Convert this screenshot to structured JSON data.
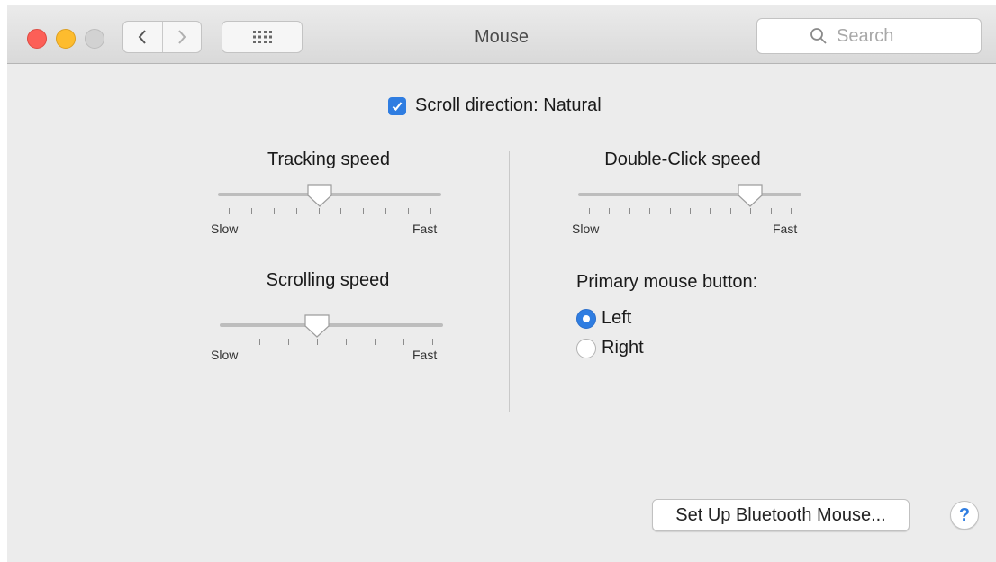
{
  "window": {
    "title": "Mouse"
  },
  "toolbar": {
    "back_icon": "chevron-left-icon",
    "forward_icon": "chevron-right-icon",
    "show_all_icon": "grid-icon",
    "search": {
      "placeholder": "Search",
      "value": "",
      "icon": "search-icon"
    }
  },
  "scroll_direction": {
    "label": "Scroll direction: Natural",
    "checked": true
  },
  "tracking_speed": {
    "label": "Tracking speed",
    "min_label": "Slow",
    "max_label": "Fast",
    "ticks": 10,
    "value": 0.45
  },
  "scrolling_speed": {
    "label": "Scrolling speed",
    "min_label": "Slow",
    "max_label": "Fast",
    "ticks": 8,
    "value": 0.43
  },
  "double_click_speed": {
    "label": "Double-Click speed",
    "min_label": "Slow",
    "max_label": "Fast",
    "ticks": 11,
    "value": 0.8
  },
  "primary_mouse_button": {
    "label": "Primary mouse button:",
    "options": [
      {
        "label": "Left",
        "selected": true
      },
      {
        "label": "Right",
        "selected": false
      }
    ]
  },
  "buttons": {
    "bluetooth_setup": "Set Up Bluetooth Mouse...",
    "help": "?"
  },
  "colors": {
    "accent": "#2f7de1",
    "close": "#fc5f57",
    "minimize": "#fdbc2e",
    "zoom": "#d2d2d2"
  }
}
